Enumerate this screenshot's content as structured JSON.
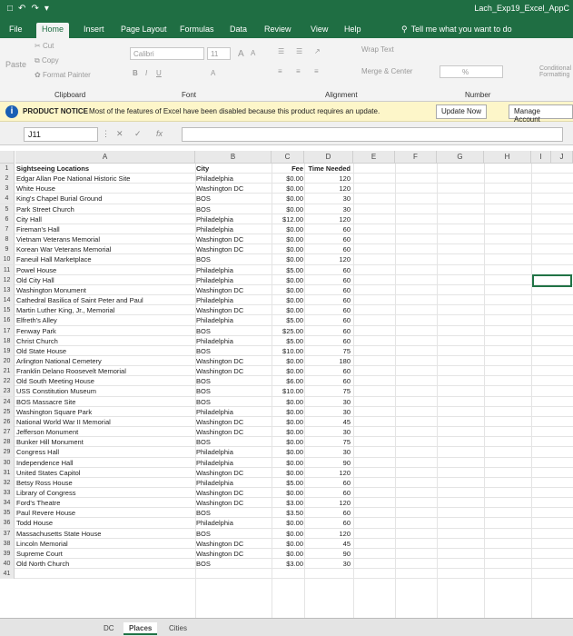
{
  "title_bar": {
    "app_title": "Lach_Exp19_Excel_AppC"
  },
  "tabs": [
    "File",
    "Home",
    "Insert",
    "Page Layout",
    "Formulas",
    "Data",
    "Review",
    "View",
    "Help"
  ],
  "tell_me": "Tell me what you want to do",
  "ribbon": {
    "cut": "Cut",
    "copy": "Copy",
    "paste": "Paste",
    "format_painter": "Format Painter",
    "font_name": "Calibri",
    "font_size": "11",
    "wrap_text": "Wrap Text",
    "merge_center": "Merge & Center",
    "groups": {
      "clipboard": "Clipboard",
      "font": "Font",
      "alignment": "Alignment",
      "number": "Number"
    },
    "conditional": "Conditional Formatting",
    "percent": "%"
  },
  "notice": {
    "title": "PRODUCT NOTICE",
    "message": "Most of the features of Excel have been disabled because this product requires an update.",
    "update_now": "Update Now",
    "manage_account": "Manage Account"
  },
  "formula_bar": {
    "name_box": "J11",
    "fx": "fx"
  },
  "columns": [
    "A",
    "B",
    "C",
    "D",
    "E",
    "F",
    "G",
    "H",
    "I",
    "J"
  ],
  "header_row": {
    "a": "Sightseeing Locations",
    "b": "City",
    "c": "Fee",
    "d": "Time Needed"
  },
  "rows": [
    {
      "n": "2",
      "a": "Edgar Allan Poe National Historic Site",
      "b": "Philadelphia",
      "c": "$0.00",
      "d": "120"
    },
    {
      "n": "3",
      "a": "White House",
      "b": "Washington DC",
      "c": "$0.00",
      "d": "120"
    },
    {
      "n": "4",
      "a": "King's Chapel Burial Ground",
      "b": "BOS",
      "c": "$0.00",
      "d": "30"
    },
    {
      "n": "5",
      "a": "Park Street Church",
      "b": "BOS",
      "c": "$0.00",
      "d": "30"
    },
    {
      "n": "6",
      "a": "City Hall",
      "b": "Philadelphia",
      "c": "$12.00",
      "d": "120"
    },
    {
      "n": "7",
      "a": "Fireman's Hall",
      "b": "Philadelphia",
      "c": "$0.00",
      "d": "60"
    },
    {
      "n": "8",
      "a": "Vietnam Veterans Memorial",
      "b": "Washington DC",
      "c": "$0.00",
      "d": "60"
    },
    {
      "n": "9",
      "a": "Korean War Veterans Memorial",
      "b": "Washington DC",
      "c": "$0.00",
      "d": "60"
    },
    {
      "n": "10",
      "a": "Faneuil Hall Marketplace",
      "b": "BOS",
      "c": "$0.00",
      "d": "120"
    },
    {
      "n": "11",
      "a": "Powel House",
      "b": "Philadelphia",
      "c": "$5.00",
      "d": "60"
    },
    {
      "n": "12",
      "a": "Old City Hall",
      "b": "Philadelphia",
      "c": "$0.00",
      "d": "60"
    },
    {
      "n": "13",
      "a": "Washington Monument",
      "b": "Washington DC",
      "c": "$0.00",
      "d": "60"
    },
    {
      "n": "14",
      "a": "Cathedral Basilica of Saint Peter and Paul",
      "b": "Philadelphia",
      "c": "$0.00",
      "d": "60"
    },
    {
      "n": "15",
      "a": "Martin Luther King, Jr., Memorial",
      "b": "Washington DC",
      "c": "$0.00",
      "d": "60"
    },
    {
      "n": "16",
      "a": "Elfreth's Alley",
      "b": "Philadelphia",
      "c": "$5.00",
      "d": "60"
    },
    {
      "n": "17",
      "a": "Fenway Park",
      "b": "BOS",
      "c": "$25.00",
      "d": "60"
    },
    {
      "n": "18",
      "a": "Christ Church",
      "b": "Philadelphia",
      "c": "$5.00",
      "d": "60"
    },
    {
      "n": "19",
      "a": "Old State House",
      "b": "BOS",
      "c": "$10.00",
      "d": "75"
    },
    {
      "n": "20",
      "a": "Arlington National Cemetery",
      "b": "Washington DC",
      "c": "$0.00",
      "d": "180"
    },
    {
      "n": "21",
      "a": "Franklin Delano Roosevelt Memorial",
      "b": "Washington DC",
      "c": "$0.00",
      "d": "60"
    },
    {
      "n": "22",
      "a": "Old South Meeting House",
      "b": "BOS",
      "c": "$6.00",
      "d": "60"
    },
    {
      "n": "23",
      "a": "USS Constitution Museum",
      "b": "BOS",
      "c": "$10.00",
      "d": "75"
    },
    {
      "n": "24",
      "a": "BOS Massacre Site",
      "b": "BOS",
      "c": "$0.00",
      "d": "30"
    },
    {
      "n": "25",
      "a": "Washington Square Park",
      "b": "Philadelphia",
      "c": "$0.00",
      "d": "30"
    },
    {
      "n": "26",
      "a": "National World War II Memorial",
      "b": "Washington DC",
      "c": "$0.00",
      "d": "45"
    },
    {
      "n": "27",
      "a": "Jefferson Monument",
      "b": "Washington DC",
      "c": "$0.00",
      "d": "30"
    },
    {
      "n": "28",
      "a": "Bunker Hill Monument",
      "b": "BOS",
      "c": "$0.00",
      "d": "75"
    },
    {
      "n": "29",
      "a": "Congress Hall",
      "b": "Philadelphia",
      "c": "$0.00",
      "d": "30"
    },
    {
      "n": "30",
      "a": "Independence Hall",
      "b": "Philadelphia",
      "c": "$0.00",
      "d": "90"
    },
    {
      "n": "31",
      "a": "United States Capitol",
      "b": "Washington DC",
      "c": "$0.00",
      "d": "120"
    },
    {
      "n": "32",
      "a": "Betsy Ross House",
      "b": "Philadelphia",
      "c": "$5.00",
      "d": "60"
    },
    {
      "n": "33",
      "a": "Library of Congress",
      "b": "Washington DC",
      "c": "$0.00",
      "d": "60"
    },
    {
      "n": "34",
      "a": "Ford's Theatre",
      "b": "Washington DC",
      "c": "$3.00",
      "d": "120"
    },
    {
      "n": "35",
      "a": "Paul Revere House",
      "b": "BOS",
      "c": "$3.50",
      "d": "60"
    },
    {
      "n": "36",
      "a": "Todd House",
      "b": "Philadelphia",
      "c": "$0.00",
      "d": "60"
    },
    {
      "n": "37",
      "a": "Massachusetts State House",
      "b": "BOS",
      "c": "$0.00",
      "d": "120"
    },
    {
      "n": "38",
      "a": "Lincoln Memorial",
      "b": "Washington DC",
      "c": "$0.00",
      "d": "45"
    },
    {
      "n": "39",
      "a": "Supreme Court",
      "b": "Washington DC",
      "c": "$0.00",
      "d": "90"
    },
    {
      "n": "40",
      "a": "Old North Church",
      "b": "BOS",
      "c": "$3.00",
      "d": "30"
    },
    {
      "n": "41",
      "a": "",
      "b": "",
      "c": "",
      "d": ""
    }
  ],
  "sheet_tabs": [
    "DC",
    "Places",
    "Cities"
  ]
}
